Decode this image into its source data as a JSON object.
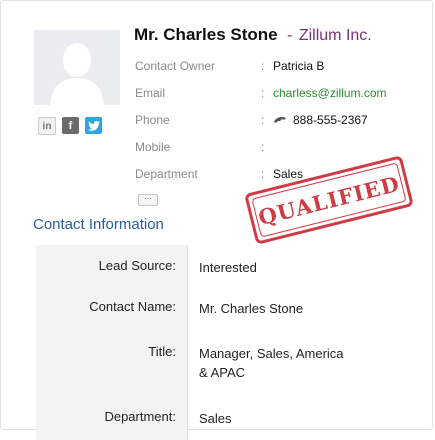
{
  "contact": {
    "name": "Mr. Charles Stone",
    "separator": "-",
    "company": "Zillum Inc."
  },
  "social": [
    {
      "icon": "linkedin-icon",
      "text": "in"
    },
    {
      "icon": "facebook-icon",
      "text": "f"
    },
    {
      "icon": "twitter-icon",
      "text": "t"
    }
  ],
  "fields": [
    {
      "label": "Contact Owner",
      "value": "Patricia B"
    },
    {
      "label": "Email",
      "value": "charless@zillum.com"
    },
    {
      "label": "Phone",
      "value": "888-555-2367"
    },
    {
      "label": "Mobile",
      "value": ""
    },
    {
      "label": "Department",
      "value": "Sales"
    }
  ],
  "more_button": "···",
  "stamp_text": "QUALIFIED",
  "section": {
    "title": "Contact Information",
    "rows": [
      {
        "key": "Lead Source:",
        "value": "Interested"
      },
      {
        "key": "Contact Name:",
        "value": "Mr. Charles Stone"
      },
      {
        "key": "Title:",
        "value": "Manager, Sales, America & APAC"
      },
      {
        "key": "Department:",
        "value": "Sales"
      }
    ]
  },
  "colors": {
    "company": "#7a2e7a",
    "email": "#2e8b2e",
    "section_title": "#2a5d9f",
    "stamp": "#c8232c"
  }
}
